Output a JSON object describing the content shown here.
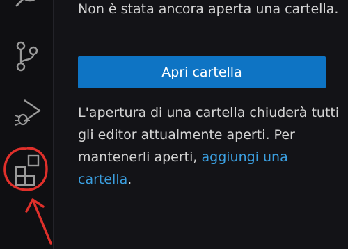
{
  "activity_bar": {
    "items": [
      {
        "name": "search",
        "icon": "search-icon"
      },
      {
        "name": "source-control",
        "icon": "source-control-icon"
      },
      {
        "name": "run-and-debug",
        "icon": "run-debug-icon"
      },
      {
        "name": "extensions",
        "icon": "extensions-icon"
      }
    ]
  },
  "explorer": {
    "no_folder_message": "Non è stata ancora aperta una cartella.",
    "open_folder_button": "Apri cartella",
    "info_text_1": "L'apertura di una cartella chiuderà tutti gli editor attualmente aperti. Per mantenerli aperti, ",
    "add_folder_link": "aggiungi una cartella",
    "info_text_2": "."
  },
  "colors": {
    "background": "#131317",
    "button": "#0e74c4",
    "link": "#3b9fe0",
    "annotation": "#e0302b"
  }
}
